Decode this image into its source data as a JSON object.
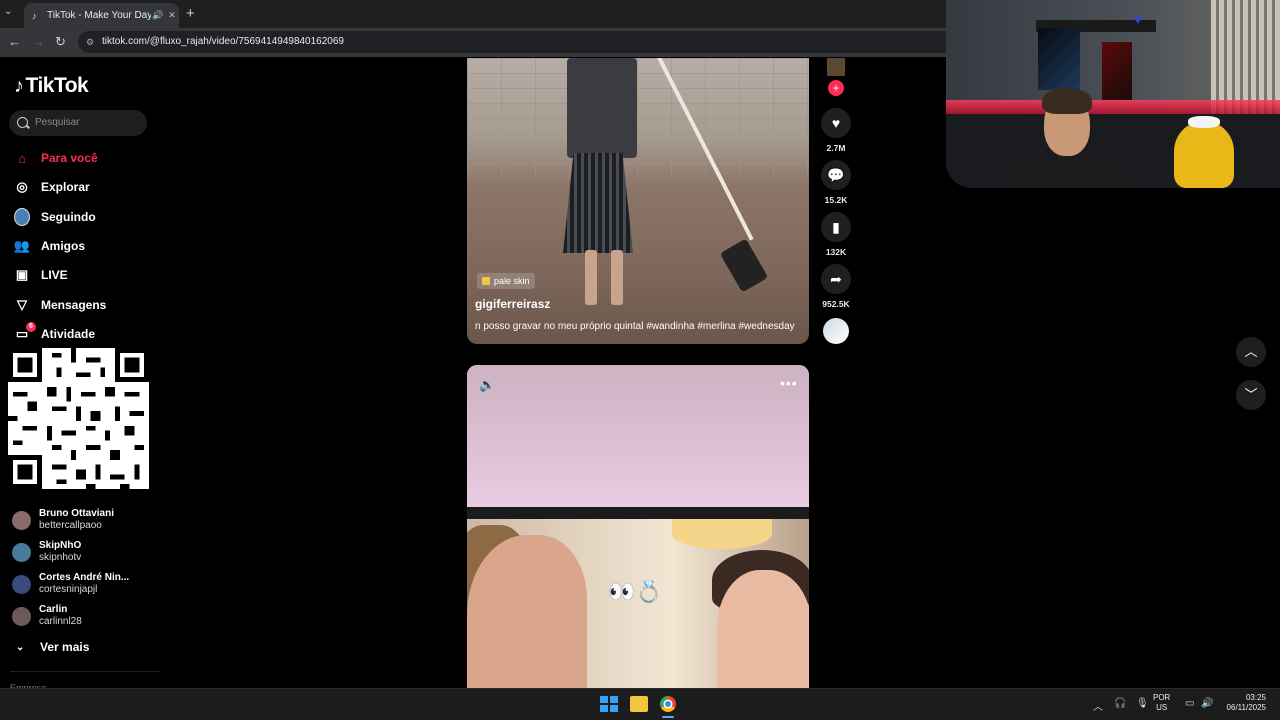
{
  "browser": {
    "tab_title": "TikTok - Make Your Day",
    "url": "tiktok.com/@fluxo_rajah/video/7569414949840162069"
  },
  "sidebar": {
    "logo": "TikTok",
    "search_placeholder": "Pesquisar",
    "nav": [
      {
        "label": "Para você",
        "icon": "home-icon",
        "active": true
      },
      {
        "label": "Explorar",
        "icon": "compass-icon"
      },
      {
        "label": "Seguindo",
        "icon": "following-avatar-icon"
      },
      {
        "label": "Amigos",
        "icon": "friends-icon"
      },
      {
        "label": "LIVE",
        "icon": "live-icon"
      },
      {
        "label": "Mensagens",
        "icon": "send-icon"
      },
      {
        "label": "Atividade",
        "icon": "inbox-icon",
        "badge": "6"
      }
    ],
    "accounts": [
      {
        "name": "Bruno Ottaviani",
        "handle": "bettercallpaoo",
        "avatar_color": "#8a6a6a"
      },
      {
        "name": "SkipNhO",
        "handle": "skipnhotv",
        "avatar_color": "#4a7a9a"
      },
      {
        "name": "Cortes André Nin...",
        "handle": "cortesninjapjl",
        "avatar_color": "#3a4a7a"
      },
      {
        "name": "Carlin",
        "handle": "carlinnl28",
        "avatar_color": "#6a5a5a"
      }
    ],
    "see_more": "Ver mais",
    "footer_label": "Empresa"
  },
  "video1": {
    "tag": "pale skin",
    "author": "gigiferreirasz",
    "caption": "n posso gravar no meu próprio quintal #wandinha #merlina #wednesday"
  },
  "actions": {
    "likes": "2.7M",
    "comments": "15.2K",
    "saves": "132K",
    "shares": "952.5K"
  },
  "video2": {
    "emoji_overlay": "👀💍"
  },
  "taskbar": {
    "lang_line1": "POR",
    "lang_line2": "US",
    "time": "03:25",
    "date": "06/11/2025"
  },
  "colors": {
    "brand_red": "#fe2c55",
    "background": "#000000"
  }
}
